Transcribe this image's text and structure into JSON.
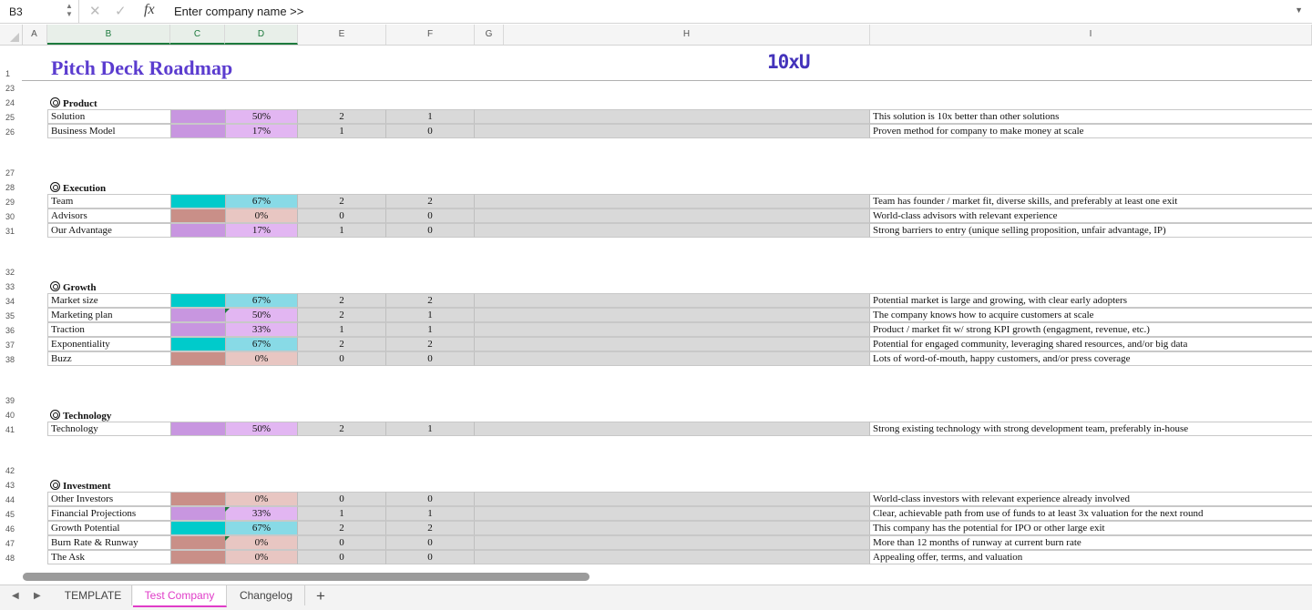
{
  "formula_bar": {
    "cell_ref": "B3",
    "formula_symbol": "fx",
    "value": "Enter company name >>"
  },
  "columns": [
    {
      "letter": "A",
      "selected": false
    },
    {
      "letter": "B",
      "selected": true
    },
    {
      "letter": "C",
      "selected": true
    },
    {
      "letter": "D",
      "selected": true
    },
    {
      "letter": "E",
      "selected": false
    },
    {
      "letter": "F",
      "selected": false
    },
    {
      "letter": "G",
      "selected": false
    },
    {
      "letter": "H",
      "selected": false
    },
    {
      "letter": "I",
      "selected": false
    }
  ],
  "sheet": {
    "title": "Pitch Deck Roadmap",
    "logo_text": "10xU",
    "colors": {
      "purple": "#c896e0",
      "purple_light": "#e2b6f2",
      "teal": "#00cbcb",
      "teal_light": "#88dae6",
      "rose": "#c98f88",
      "rose_light": "#e8c6c2",
      "band": "#d9d9d9"
    },
    "sections": [
      {
        "row_blank": "23",
        "row_header": "24",
        "name": "Product",
        "items": [
          {
            "row": "25",
            "label": "Solution",
            "pct": "50%",
            "e": "2",
            "f": "1",
            "color": "purple",
            "flag": false,
            "desc": "This solution is 10x better than other solutions"
          },
          {
            "row": "26",
            "label": "Business Model",
            "pct": "17%",
            "e": "1",
            "f": "0",
            "color": "purple",
            "flag": false,
            "desc": "Proven method for company to make money at scale"
          }
        ]
      },
      {
        "row_blank": "27",
        "row_header": "28",
        "name": "Execution",
        "items": [
          {
            "row": "29",
            "label": "Team",
            "pct": "67%",
            "e": "2",
            "f": "2",
            "color": "teal",
            "flag": false,
            "desc": "Team has founder / market fit, diverse skills, and preferably at least one exit"
          },
          {
            "row": "30",
            "label": "Advisors",
            "pct": "0%",
            "e": "0",
            "f": "0",
            "color": "rose",
            "flag": false,
            "desc": "World-class advisors with relevant experience"
          },
          {
            "row": "31",
            "label": "Our Advantage",
            "pct": "17%",
            "e": "1",
            "f": "0",
            "color": "purple",
            "flag": false,
            "desc": "Strong barriers to entry (unique selling proposition, unfair advantage, IP)"
          }
        ]
      },
      {
        "row_blank": "32",
        "row_header": "33",
        "name": "Growth",
        "items": [
          {
            "row": "34",
            "label": "Market size",
            "pct": "67%",
            "e": "2",
            "f": "2",
            "color": "teal",
            "flag": false,
            "desc": "Potential market is large and growing, with clear early adopters"
          },
          {
            "row": "35",
            "label": "Marketing plan",
            "pct": "50%",
            "e": "2",
            "f": "1",
            "color": "purple",
            "flag": true,
            "desc": "The company knows how to acquire customers at scale"
          },
          {
            "row": "36",
            "label": "Traction",
            "pct": "33%",
            "e": "1",
            "f": "1",
            "color": "purple",
            "flag": false,
            "desc": "Product / market fit w/ strong KPI growth (engagment, revenue, etc.)"
          },
          {
            "row": "37",
            "label": "Exponentiality",
            "pct": "67%",
            "e": "2",
            "f": "2",
            "color": "teal",
            "flag": false,
            "desc": "Potential for engaged community, leveraging shared resources, and/or big data"
          },
          {
            "row": "38",
            "label": "Buzz",
            "pct": "0%",
            "e": "0",
            "f": "0",
            "color": "rose",
            "flag": false,
            "desc": "Lots of word-of-mouth, happy customers, and/or press coverage"
          }
        ]
      },
      {
        "row_blank": "39",
        "row_header": "40",
        "name": "Technology",
        "items": [
          {
            "row": "41",
            "label": "Technology",
            "pct": "50%",
            "e": "2",
            "f": "1",
            "color": "purple",
            "flag": false,
            "desc": "Strong existing technology with strong development team, preferably in-house"
          }
        ]
      },
      {
        "row_blank": "42",
        "row_header": "43",
        "name": "Investment",
        "items": [
          {
            "row": "44",
            "label": "Other Investors",
            "pct": "0%",
            "e": "0",
            "f": "0",
            "color": "rose",
            "flag": false,
            "desc": "World-class investors with relevant experience already involved"
          },
          {
            "row": "45",
            "label": "Financial Projections",
            "pct": "33%",
            "e": "1",
            "f": "1",
            "color": "purple",
            "flag": true,
            "desc": "Clear, achievable path from use of funds to at least 3x valuation for the next round"
          },
          {
            "row": "46",
            "label": "Growth Potential",
            "pct": "67%",
            "e": "2",
            "f": "2",
            "color": "teal",
            "flag": false,
            "desc": "This company has the potential for IPO or other large exit"
          },
          {
            "row": "47",
            "label": "Burn Rate & Runway",
            "pct": "0%",
            "e": "0",
            "f": "0",
            "color": "rose",
            "flag": true,
            "desc": "More than 12 months of runway at current burn rate"
          },
          {
            "row": "48",
            "label": "The Ask",
            "pct": "0%",
            "e": "0",
            "f": "0",
            "color": "rose",
            "flag": false,
            "desc": "Appealing offer, terms, and valuation"
          }
        ]
      }
    ]
  },
  "tabs": {
    "items": [
      "TEMPLATE",
      "Test Company",
      "Changelog"
    ],
    "active": "Test Company",
    "add_label": "+"
  }
}
